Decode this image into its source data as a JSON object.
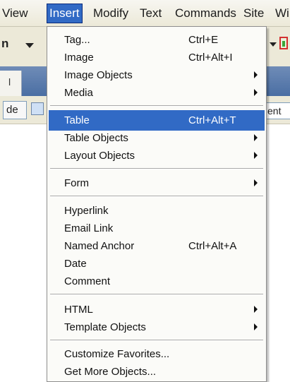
{
  "menubar": {
    "items": [
      {
        "label": "View"
      },
      {
        "label": "Insert"
      },
      {
        "label": "Modify"
      },
      {
        "label": "Text"
      },
      {
        "label": "Commands"
      },
      {
        "label": "Site"
      },
      {
        "label": "Wi"
      }
    ],
    "active_index": 1
  },
  "background": {
    "toolbar_label": "n",
    "tab_label": "l",
    "doc_button_label": "de",
    "right_field_text": "ent"
  },
  "insert_menu": {
    "highlight_color": "#316ac5",
    "items": [
      {
        "label": "Tag...",
        "shortcut": "Ctrl+E",
        "submenu": false
      },
      {
        "label": "Image",
        "shortcut": "Ctrl+Alt+I",
        "submenu": false
      },
      {
        "label": "Image Objects",
        "shortcut": "",
        "submenu": true
      },
      {
        "label": "Media",
        "shortcut": "",
        "submenu": true
      },
      {
        "separator": true
      },
      {
        "label": "Table",
        "shortcut": "Ctrl+Alt+T",
        "submenu": false,
        "highlighted": true
      },
      {
        "label": "Table Objects",
        "shortcut": "",
        "submenu": true
      },
      {
        "label": "Layout Objects",
        "shortcut": "",
        "submenu": true
      },
      {
        "separator": true
      },
      {
        "label": "Form",
        "shortcut": "",
        "submenu": true
      },
      {
        "separator": true
      },
      {
        "label": "Hyperlink",
        "shortcut": "",
        "submenu": false
      },
      {
        "label": "Email Link",
        "shortcut": "",
        "submenu": false
      },
      {
        "label": "Named Anchor",
        "shortcut": "Ctrl+Alt+A",
        "submenu": false
      },
      {
        "label": "Date",
        "shortcut": "",
        "submenu": false
      },
      {
        "label": "Comment",
        "shortcut": "",
        "submenu": false
      },
      {
        "separator": true
      },
      {
        "label": "HTML",
        "shortcut": "",
        "submenu": true
      },
      {
        "label": "Template Objects",
        "shortcut": "",
        "submenu": true
      },
      {
        "separator": true
      },
      {
        "label": "Customize Favorites...",
        "shortcut": "",
        "submenu": false
      },
      {
        "label": "Get More Objects...",
        "shortcut": "",
        "submenu": false
      }
    ]
  }
}
